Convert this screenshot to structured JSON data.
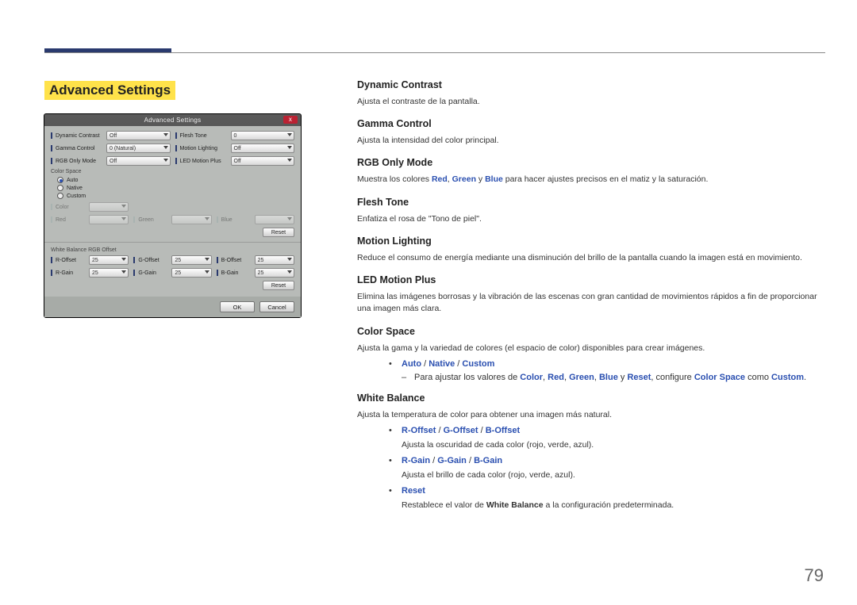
{
  "page_number": "79",
  "heading": "Advanced Settings",
  "dialog": {
    "title": "Advanced Settings",
    "close": "x",
    "fields": {
      "dynamic_contrast": {
        "label": "Dynamic Contrast",
        "value": "Off"
      },
      "gamma_control": {
        "label": "Gamma Control",
        "value": "0 (Natural)"
      },
      "rgb_only_mode": {
        "label": "RGB Only Mode",
        "value": "Off"
      },
      "flesh_tone": {
        "label": "Flesh Tone",
        "value": "0"
      },
      "motion_lighting": {
        "label": "Motion Lighting",
        "value": "Off"
      },
      "led_motion_plus": {
        "label": "LED Motion Plus",
        "value": "Off"
      }
    },
    "color_space": {
      "title": "Color Space",
      "radios": {
        "auto": "Auto",
        "native": "Native",
        "custom": "Custom"
      },
      "selected": "auto",
      "custom_fields": {
        "color": {
          "label": "Color",
          "value": ""
        },
        "red": {
          "label": "Red",
          "value": ""
        },
        "green": {
          "label": "Green",
          "value": ""
        },
        "blue": {
          "label": "Blue",
          "value": ""
        }
      },
      "reset": "Reset"
    },
    "white_balance": {
      "title": "White Balance RGB Offset",
      "fields": {
        "r_offset": {
          "label": "R-Offset",
          "value": "25"
        },
        "g_offset": {
          "label": "G-Offset",
          "value": "25"
        },
        "b_offset": {
          "label": "B-Offset",
          "value": "25"
        },
        "r_gain": {
          "label": "R-Gain",
          "value": "25"
        },
        "g_gain": {
          "label": "G-Gain",
          "value": "25"
        },
        "b_gain": {
          "label": "B-Gain",
          "value": "25"
        }
      },
      "reset": "Reset"
    },
    "buttons": {
      "ok": "OK",
      "cancel": "Cancel"
    }
  },
  "rhs": {
    "dynamic_contrast": {
      "h": "Dynamic Contrast",
      "p": "Ajusta el contraste de la pantalla."
    },
    "gamma_control": {
      "h": "Gamma Control",
      "p": "Ajusta la intensidad del color principal."
    },
    "rgb_only_mode": {
      "h": "RGB Only Mode",
      "p1": "Muestra los colores ",
      "red": "Red",
      "c1": ", ",
      "green": "Green",
      "c2": " y ",
      "blue": "Blue",
      "p2": " para hacer ajustes precisos en el matiz y la saturación."
    },
    "flesh_tone": {
      "h": "Flesh Tone",
      "p": "Enfatiza el rosa de \"Tono de piel\"."
    },
    "motion_lighting": {
      "h": "Motion Lighting",
      "p": "Reduce el consumo de energía mediante una disminución del brillo de la pantalla cuando la imagen está en movimiento."
    },
    "led_motion_plus": {
      "h": "LED Motion Plus",
      "p": "Elimina las imágenes borrosas y la vibración de las escenas con gran cantidad de movimientos rápidos a fin de proporcionar una imagen más clara."
    },
    "color_space": {
      "h": "Color Space",
      "p": "Ajusta la gama y la variedad de colores (el espacio de color) disponibles para crear imágenes.",
      "opt_auto": "Auto",
      "sep": " / ",
      "opt_native": "Native",
      "opt_custom": "Custom",
      "dash_pre": "Para ajustar los valores de ",
      "k_color": "Color",
      "c1": ", ",
      "k_red": "Red",
      "c2": ", ",
      "k_green": "Green",
      "c3": ", ",
      "k_blue": "Blue",
      "c4": " y ",
      "k_reset": "Reset",
      "dash_mid": ", configure ",
      "k_cs": "Color Space",
      "dash_mid2": " como ",
      "k_custom2": "Custom",
      "dash_end": "."
    },
    "white_balance": {
      "h": "White Balance",
      "p": "Ajusta la temperatura de color para obtener una imagen más natural.",
      "off_r": "R-Offset",
      "sep": " / ",
      "off_g": "G-Offset",
      "off_b": "B-Offset",
      "off_desc": "Ajusta la oscuridad de cada color (rojo, verde, azul).",
      "gain_r": "R-Gain",
      "gain_g": "G-Gain",
      "gain_b": "B-Gain",
      "gain_desc": "Ajusta el brillo de cada color (rojo, verde, azul).",
      "reset": "Reset",
      "reset_pre": "Restablece el valor de ",
      "reset_wb": "White Balance",
      "reset_post": " a la configuración predeterminada."
    }
  }
}
